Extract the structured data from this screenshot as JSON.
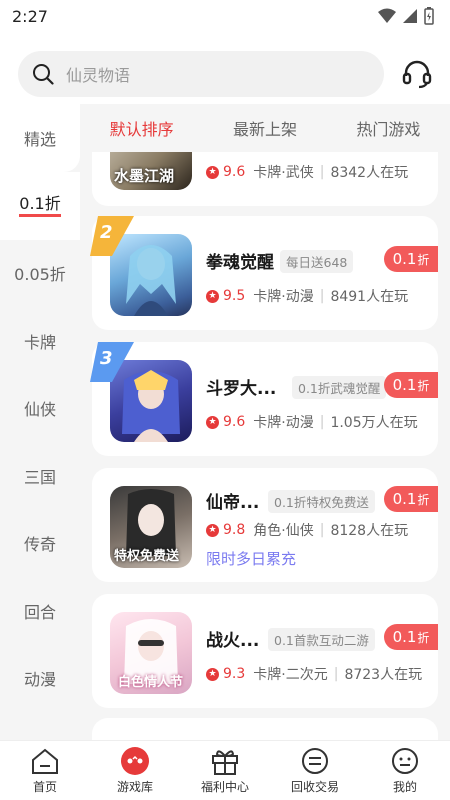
{
  "status_bar": {
    "time": "2:27"
  },
  "search": {
    "placeholder": "仙灵物语"
  },
  "sidebar": {
    "items": [
      {
        "label": "精选"
      },
      {
        "label": "0.1折"
      },
      {
        "label": "0.05折"
      },
      {
        "label": "卡牌"
      },
      {
        "label": "仙侠"
      },
      {
        "label": "三国"
      },
      {
        "label": "传奇"
      },
      {
        "label": "回合"
      },
      {
        "label": "动漫"
      }
    ]
  },
  "sort_tabs": [
    {
      "label": "默认排序"
    },
    {
      "label": "最新上架"
    },
    {
      "label": "热门游戏"
    }
  ],
  "games": [
    {
      "name": "",
      "tag": "",
      "discount": "",
      "discount_unit": "",
      "score": "9.6",
      "category": "卡牌·武侠",
      "players": "8342人在玩",
      "icon_text": "水墨江湖"
    },
    {
      "rank": "2",
      "name": "拳魂觉醒",
      "tag": "每日送648",
      "discount": "0.1",
      "discount_unit": "折",
      "score": "9.5",
      "category": "卡牌·动漫",
      "players": "8491人在玩"
    },
    {
      "rank": "3",
      "name": "斗罗大...",
      "tag": "0.1折武魂觉醒",
      "discount": "0.1",
      "discount_unit": "折",
      "score": "9.6",
      "category": "卡牌·动漫",
      "players": "1.05万人在玩"
    },
    {
      "name": "仙帝...",
      "tag": "0.1折特权免费送",
      "discount": "0.1",
      "discount_unit": "折",
      "score": "9.8",
      "category": "角色·仙侠",
      "players": "8128人在玩",
      "promo": "限时多日累充",
      "icon_text": "特权免费送"
    },
    {
      "name": "战火...",
      "tag": "0.1首款互动二游",
      "discount": "0.1",
      "discount_unit": "折",
      "score": "9.3",
      "category": "卡牌·二次元",
      "players": "8723人在玩",
      "icon_text": "白色情人节"
    }
  ],
  "bottom_nav": [
    {
      "label": "首页"
    },
    {
      "label": "游戏库"
    },
    {
      "label": "福利中心"
    },
    {
      "label": "回收交易"
    },
    {
      "label": "我的"
    }
  ],
  "colors": {
    "accent": "#e63a3a",
    "discount_bg": "#f25a5a",
    "promo": "#7b7bf0",
    "sidebar_bg": "#f5f5f5"
  }
}
